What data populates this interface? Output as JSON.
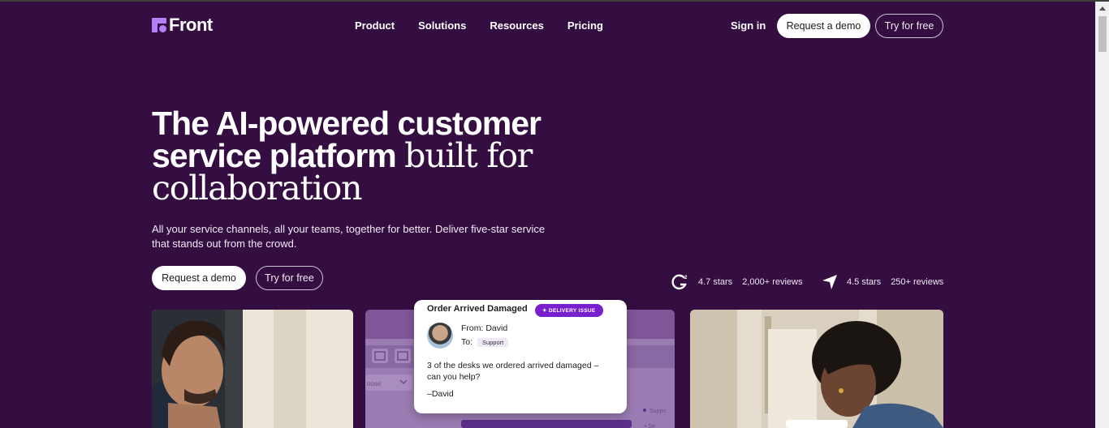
{
  "brand": {
    "name": "Front",
    "logo_color": "#b67ef7"
  },
  "nav": {
    "items": [
      "Product",
      "Solutions",
      "Resources",
      "Pricing"
    ]
  },
  "auth": {
    "sign_in": "Sign in",
    "request_demo": "Request a demo",
    "try_free": "Try for free"
  },
  "hero": {
    "headline_part1": "The AI-powered customer service platform",
    "headline_part2": "built for collaboration",
    "subtitle": "All your service channels, all your teams, together for better. Deliver five-star service that stands out from the crowd.",
    "request_demo": "Request a demo",
    "try_free": "Try for free"
  },
  "ratings": [
    {
      "icon": "g2-icon",
      "stars": "4.7 stars",
      "reviews": "2,000+ reviews"
    },
    {
      "icon": "capterra-icon",
      "stars": "4.5 stars",
      "reviews": "250+ reviews"
    }
  ],
  "message_card": {
    "title": "Order Arrived Damaged",
    "tag": "DELIVERY ISSUE",
    "from_label": "From:",
    "from_name": "David",
    "to_label": "To:",
    "to_value": "Support",
    "body": "3 of the desks we ordered arrived damaged – can you help?",
    "signature": "–David"
  },
  "colors": {
    "background": "#340d41",
    "accent": "#7a1fcc",
    "panel": "#7a4f96"
  }
}
